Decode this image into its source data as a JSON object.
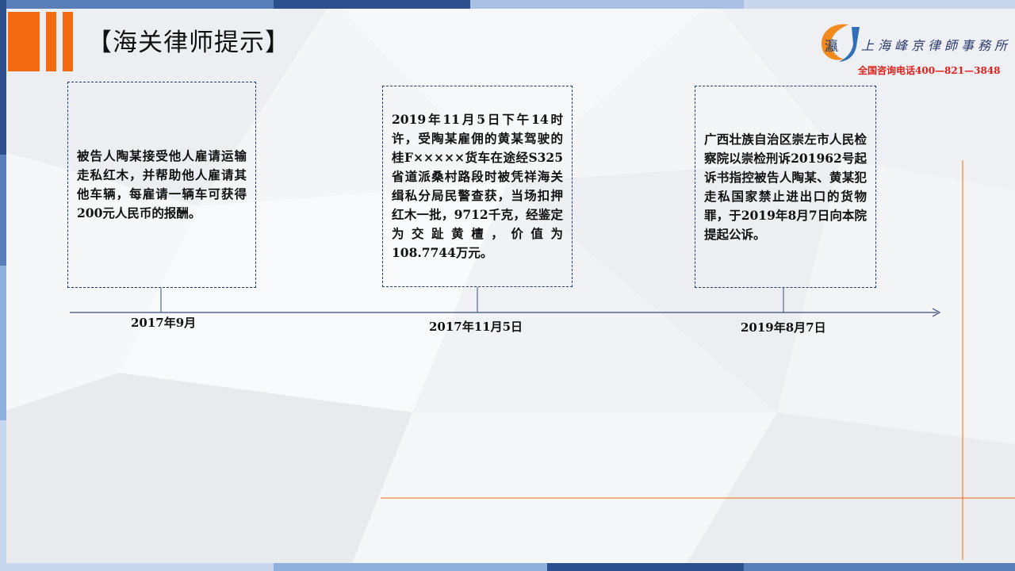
{
  "slide": {
    "title": "【海关律师提示】"
  },
  "logo": {
    "mark_text": "瀛",
    "name": "上海峰京律師事務所",
    "phone": "全国咨询电话400—821—3848"
  },
  "timeline": {
    "events": [
      {
        "text": "被告人陶某接受他人雇请运输走私红木，并帮助他人雇请其他车辆，每雇请一辆车可获得200元人民币的报酬。",
        "date": "2017年9月"
      },
      {
        "text": "2019年11月5日下午14时许，受陶某雇佣的黄某驾驶的桂F×××××货车在途经S325省道派桑村路段时被凭祥海关缉私分局民警查获，当场扣押红木一批，9712千克，经鉴定为交趾黄檀，价值为108.7744万元。",
        "date": "2017年11月5日"
      },
      {
        "text": "广西壮族自治区崇左市人民检察院以崇检刑诉201962号起诉书指控被告人陶某、黄某犯走私国家禁止进出口的货物罪，于2019年8月7日向本院提起公诉。",
        "date": "2019年8月7日"
      }
    ]
  },
  "colors": {
    "accent": "#f26a12",
    "navy": "#1f3a6e",
    "line": "#3a4a7a",
    "phone": "#e0201b"
  }
}
